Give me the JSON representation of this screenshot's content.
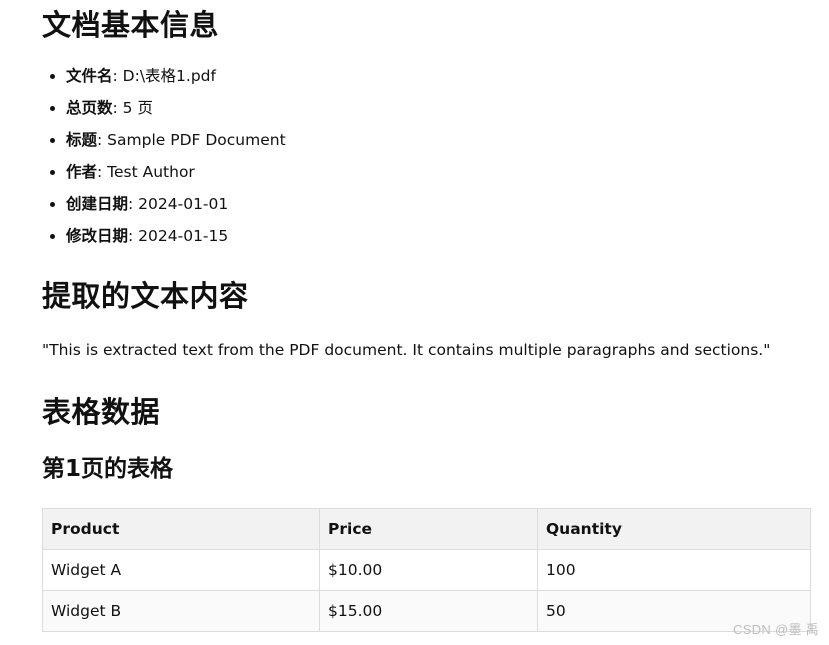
{
  "sections": {
    "basic_info": {
      "heading": "文档基本信息",
      "items": [
        {
          "label": "文件名",
          "value": "D:\\表格1.pdf"
        },
        {
          "label": "总页数",
          "value": "5 页"
        },
        {
          "label": "标题",
          "value": "Sample PDF Document"
        },
        {
          "label": "作者",
          "value": "Test Author"
        },
        {
          "label": "创建日期",
          "value": "2024-01-01"
        },
        {
          "label": "修改日期",
          "value": "2024-01-15"
        }
      ]
    },
    "extracted_text": {
      "heading": "提取的文本内容",
      "text": "\"This is extracted text from the PDF document. It contains multiple paragraphs and sections.\""
    },
    "tables": {
      "heading": "表格数据",
      "page_heading": "第1页的表格",
      "columns": [
        "Product",
        "Price",
        "Quantity"
      ],
      "rows": [
        [
          "Widget A",
          "$10.00",
          "100"
        ],
        [
          "Widget B",
          "$15.00",
          "50"
        ]
      ]
    }
  },
  "watermark": "CSDN @墨 禹"
}
